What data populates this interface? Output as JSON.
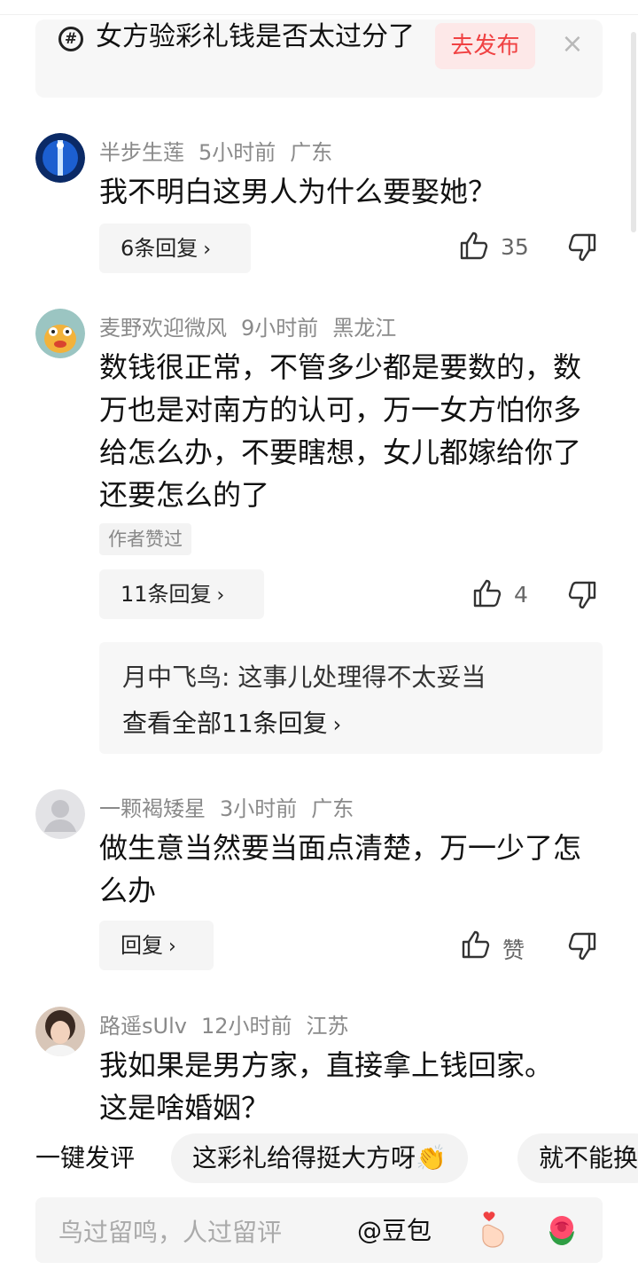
{
  "topic": {
    "title": "女方验彩礼钱是否太过分了",
    "publish_label": "去发布",
    "close_glyph": "×"
  },
  "comments": [
    {
      "user": "半步生莲",
      "time": "5小时前",
      "location": "广东",
      "text": "我不明白这男人为什么要娶她？",
      "reply_label": "6条回复",
      "likes": "35",
      "avatar_icon": "blue-figure-avatar"
    },
    {
      "user": "麦野欢迎微风",
      "time": "9小时前",
      "location": "黑龙江",
      "text": "数钱很正常，不管多少都是要数的，数万也是对南方的认可，万一女方怕你多给怎么办，不要瞎想，女儿都嫁给你了还要怎么的了",
      "badge": "作者赞过",
      "reply_label": "11条回复",
      "likes": "4",
      "avatar_icon": "cartoon-monster-avatar",
      "sub_reply": {
        "user": "月中飞鸟",
        "text": "这事儿处理得不太妥当",
        "view_all": "查看全部11条回复"
      }
    },
    {
      "user": "一颗褐矮星",
      "time": "3小时前",
      "location": "广东",
      "text": "做生意当然要当面点清楚，万一少了怎么办",
      "reply_label": "回复",
      "likes": "赞",
      "avatar_icon": "default-user-avatar"
    },
    {
      "user": "路遥sUlv",
      "time": "12小时前",
      "location": "江苏",
      "text": "我如果是男方家，直接拿上钱回家。这是啥婚姻？",
      "avatar_icon": "woman-photo-avatar"
    }
  ],
  "quick_comment": {
    "label": "一键发评",
    "chips": [
      "这彩礼给得挺大方呀👏",
      "就不能换"
    ]
  },
  "input_bar": {
    "placeholder": "鸟过留鸣，人过留评",
    "at_label": "@豆包"
  },
  "colors": {
    "accent": "#f04142",
    "accent_bg": "#fde8e8",
    "meta": "#8a8a8a"
  }
}
